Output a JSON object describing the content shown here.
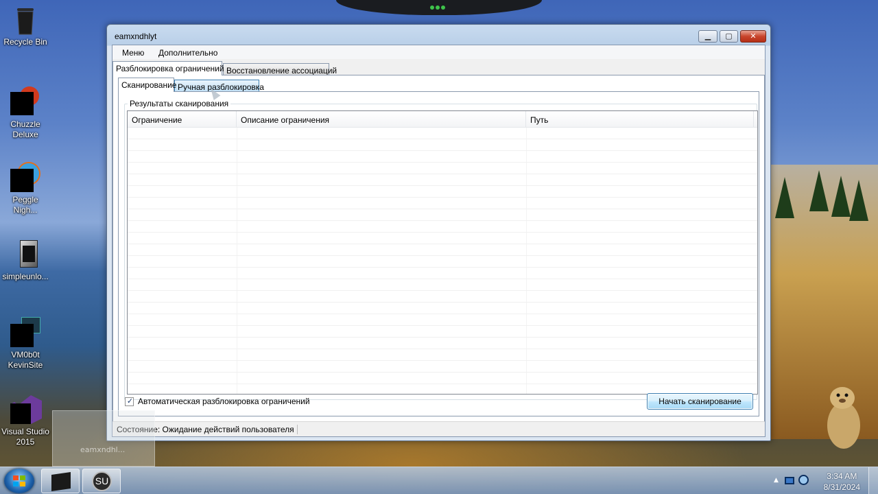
{
  "desktop": {
    "icons": [
      {
        "label": "Recycle Bin"
      },
      {
        "label": "Chuzzle\nDeluxe"
      },
      {
        "label": "Peggle\nNigh..."
      },
      {
        "label": "simpleunlo..."
      },
      {
        "label": "VM0b0t\nKevinSite"
      },
      {
        "label": "Visual Studio\n2015"
      }
    ],
    "ghost_label": "eamxndhl..."
  },
  "window": {
    "title": "eamxndhlyt",
    "controls": {
      "minimize": "▁",
      "maximize": "▢",
      "close": "✕"
    },
    "menu": [
      "Меню",
      "Дополнительно"
    ],
    "main_tabs": [
      "Разблокировка ограничений",
      "Восстановление ассоциаций"
    ],
    "sub_tabs": [
      "Сканирование",
      "Ручная разблокировка"
    ],
    "group_title": "Результаты сканирования",
    "columns": [
      "Ограничение",
      "Описание ограничения",
      "Путь"
    ],
    "rows": [],
    "auto_unlock": {
      "label": "Автоматическая разблокировка ограничений",
      "checked": true
    },
    "scan_button": "Начать сканирование",
    "status": "Состояние: Ожидание действий пользователя"
  },
  "taskbar": {
    "time": "3:34 AM",
    "date": "8/31/2024",
    "pinned": [
      "app-black-box-icon",
      "su-app-icon"
    ],
    "su_label": "SU"
  }
}
